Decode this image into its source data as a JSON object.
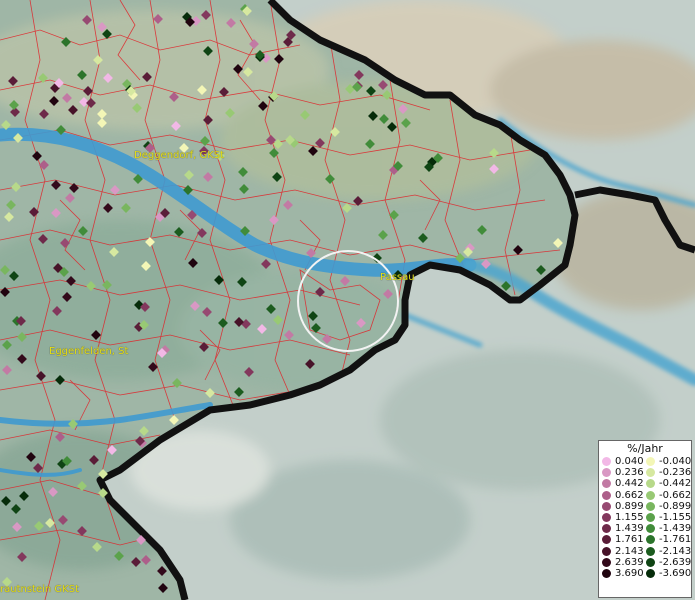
{
  "map": {
    "places": [
      {
        "label": "Deggendorf, GKSt",
        "id": "place-deggendorf"
      },
      {
        "label": "Passau",
        "id": "place-passau"
      },
      {
        "label": "Eggenfelden, St",
        "id": "place-eggenfelden"
      },
      {
        "label": "rautnstein GKSt",
        "id": "place-rautnstein"
      }
    ],
    "colors": {
      "river": "#3f9ad0",
      "border": "#111111",
      "boundaries": "#e0242a",
      "place_label": "#e6e016"
    }
  },
  "legend": {
    "title": "%/Jahr",
    "positive": [
      {
        "label": "0.040",
        "color": "#f2b8e6"
      },
      {
        "label": "0.236",
        "color": "#d998c4"
      },
      {
        "label": "0.442",
        "color": "#c27aa4"
      },
      {
        "label": "0.662",
        "color": "#ad5f8a"
      },
      {
        "label": "0.899",
        "color": "#974a72"
      },
      {
        "label": "1.155",
        "color": "#83385d"
      },
      {
        "label": "1.439",
        "color": "#6e2a4a"
      },
      {
        "label": "1.761",
        "color": "#5a1d38"
      },
      {
        "label": "2.143",
        "color": "#471329"
      },
      {
        "label": "2.639",
        "color": "#330a1b"
      },
      {
        "label": "3.690",
        "color": "#20040f"
      }
    ],
    "negative": [
      {
        "label": "-0.040",
        "color": "#f3f6b6"
      },
      {
        "label": "-0.236",
        "color": "#d6e8a0"
      },
      {
        "label": "-0.442",
        "color": "#b7d98a"
      },
      {
        "label": "-0.662",
        "color": "#98c974"
      },
      {
        "label": "-0.899",
        "color": "#79b65f"
      },
      {
        "label": "-1.155",
        "color": "#5ba24b"
      },
      {
        "label": "-1.439",
        "color": "#418c3a"
      },
      {
        "label": "-1.761",
        "color": "#2c742b"
      },
      {
        "label": "-2.143",
        "color": "#1c5c1f"
      },
      {
        "label": "-2.639",
        "color": "#0f4414"
      },
      {
        "label": "-3.690",
        "color": "#062c0a"
      }
    ]
  }
}
